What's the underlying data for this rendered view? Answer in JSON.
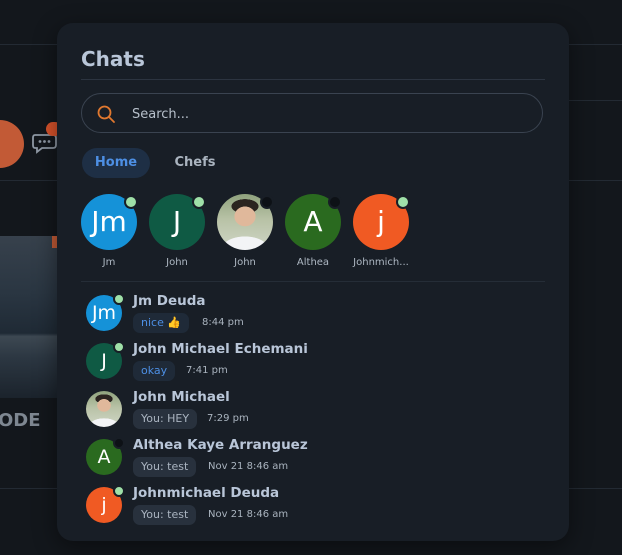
{
  "background": {
    "bottom_text": "ODE"
  },
  "panel": {
    "title": "Chats",
    "search": {
      "placeholder": "Search..."
    },
    "tabs": [
      {
        "label": "Home",
        "active": true
      },
      {
        "label": "Chefs",
        "active": false
      }
    ],
    "stories": [
      {
        "initial": "Jm",
        "name": "Jm",
        "color": "#1592d8",
        "online": true
      },
      {
        "initial": "J",
        "name": "John",
        "color": "#0f5a44",
        "online": true
      },
      {
        "initial": "",
        "name": "John",
        "photo": true,
        "online": false
      },
      {
        "initial": "A",
        "name": "Althea",
        "color": "#2a6a1f",
        "online": false
      },
      {
        "initial": "j",
        "name": "Johnmich...",
        "color": "#f05a23",
        "online": true
      }
    ],
    "chats": [
      {
        "initial": "Jm",
        "color": "#1592d8",
        "name": "Jm Deuda",
        "message": "nice 👍",
        "unread": true,
        "time": "8:44 pm",
        "online": true
      },
      {
        "initial": "J",
        "color": "#0f5a44",
        "name": "John Michael Echemani",
        "message": "okay",
        "unread": true,
        "time": "7:41 pm",
        "online": true
      },
      {
        "initial": "",
        "photo": true,
        "name": "John Michael",
        "message": "You: HEY",
        "unread": false,
        "time": "7:29 pm",
        "online": false
      },
      {
        "initial": "A",
        "color": "#2a6a1f",
        "name": "Althea Kaye Arranguez",
        "message": "You: test",
        "unread": false,
        "time": "Nov 21 8:46 am",
        "online": false
      },
      {
        "initial": "j",
        "color": "#f05a23",
        "name": "Johnmichael Deuda",
        "message": "You: test",
        "unread": false,
        "time": "Nov 21 8:46 am",
        "online": true
      }
    ],
    "status_colors": {
      "online": "#9fe0a8",
      "offline": "#0d1116"
    },
    "icons": {
      "search": "search-icon",
      "background_chat": "chat-bubble-icon"
    }
  }
}
